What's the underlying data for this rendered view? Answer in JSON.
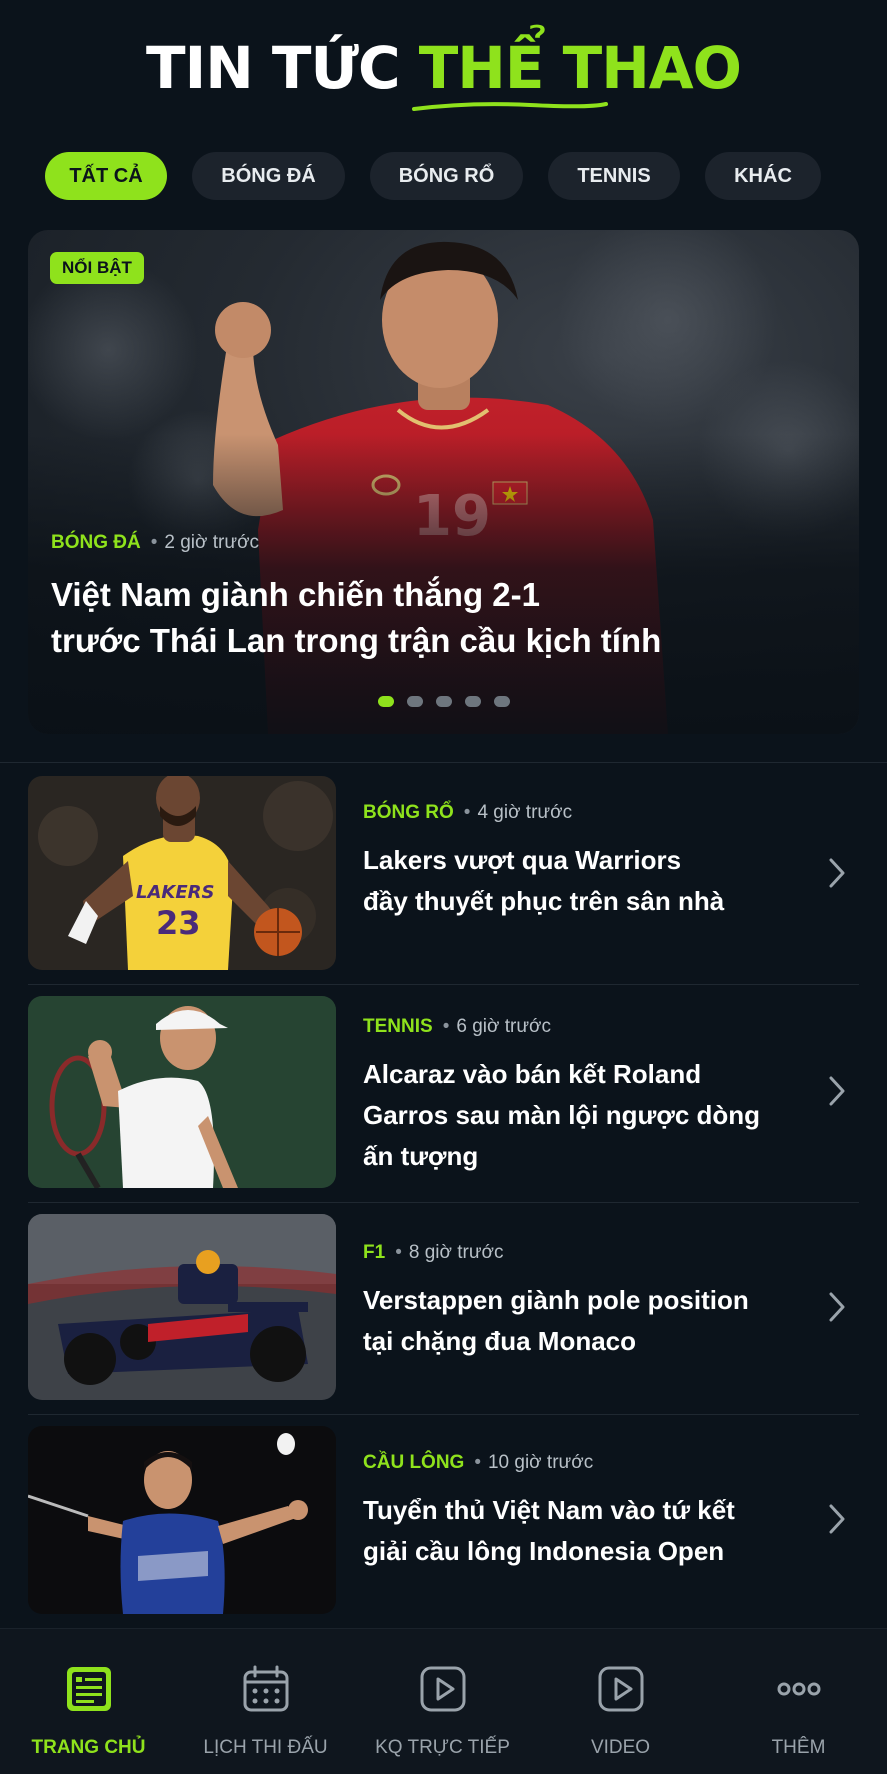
{
  "header": {
    "title_white": "TIN TỨC",
    "title_green": "THỂ THAO"
  },
  "tabs": [
    {
      "label": "TẤT CẢ",
      "active": true
    },
    {
      "label": "BÓNG ĐÁ",
      "active": false
    },
    {
      "label": "BÓNG RỔ",
      "active": false
    },
    {
      "label": "TENNIS",
      "active": false
    },
    {
      "label": "KHÁC",
      "active": false
    }
  ],
  "hero": {
    "badge": "NỔI BẬT",
    "category": "BÓNG ĐÁ",
    "time": "2 giờ trước",
    "title_line1": "Việt Nam giành chiến thắng 2-1",
    "title_line2": "trước Thái Lan trong trận cầu kịch tính",
    "jersey_number": "19",
    "slides_total": 5,
    "slide_active": 1
  },
  "news": [
    {
      "category": "BÓNG RỔ",
      "time": "4 giờ trước",
      "title_line1": "Lakers vượt qua Warriors",
      "title_line2": "đầy thuyết phục trên sân nhà",
      "title_line3": "",
      "jersey_text": "LAKERS",
      "jersey_number": "23"
    },
    {
      "category": "TENNIS",
      "time": "6 giờ trước",
      "title_line1": "Alcaraz vào bán kết Roland",
      "title_line2": "Garros sau màn lội ngược dòng",
      "title_line3": "ấn tượng"
    },
    {
      "category": "F1",
      "time": "8 giờ trước",
      "title_line1": "Verstappen giành pole position",
      "title_line2": "tại chặng đua Monaco",
      "title_line3": ""
    },
    {
      "category": "CẦU LÔNG",
      "time": "10 giờ trước",
      "title_line1": "Tuyển thủ Việt Nam vào tứ kết",
      "title_line2": "giải cầu lông Indonesia Open",
      "title_line3": ""
    }
  ],
  "bottom_nav": [
    {
      "label": "TRANG CHỦ",
      "icon": "news-icon",
      "active": true
    },
    {
      "label": "LỊCH THI ĐẤU",
      "icon": "calendar-icon",
      "active": false
    },
    {
      "label": "KQ TRỰC TIẾP",
      "icon": "play-icon",
      "active": false
    },
    {
      "label": "VIDEO",
      "icon": "play-icon",
      "active": false
    },
    {
      "label": "THÊM",
      "icon": "more-icon",
      "active": false
    }
  ],
  "colors": {
    "accent": "#8fe21c",
    "background": "#0b131b",
    "pill": "#1c232c"
  }
}
